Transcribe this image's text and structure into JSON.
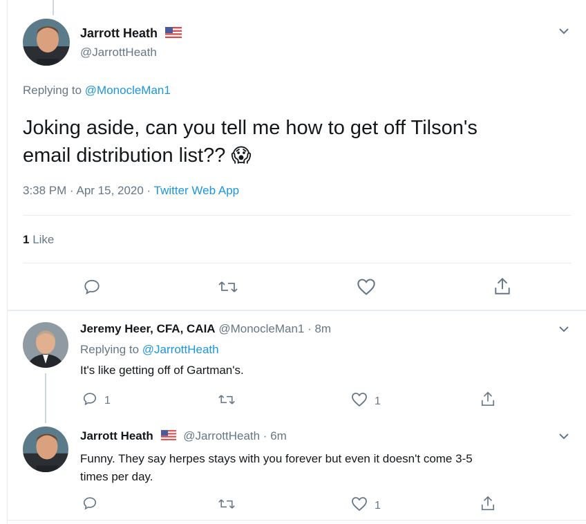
{
  "main_tweet": {
    "author_name": "Jarrott Heath",
    "handle": "@JarrottHeath",
    "replying_prefix": "Replying to",
    "replying_to": "@MonocleMan1",
    "text_line1": "Joking aside, can you tell me how to get off Tilson's",
    "text_line2": "email distribution list??",
    "emoji": "😱",
    "time_date": "3:38 PM · Apr 15, 2020 ·",
    "source": "Twitter Web App",
    "likes_count": "1",
    "likes_label": "Like"
  },
  "replies": [
    {
      "author_name": "Jeremy Heer, CFA, CAIA",
      "handle_time": "@MonocleMan1 · 8m",
      "replying_prefix": "Replying to",
      "replying_to": "@JarrottHeath",
      "text": "It's like getting off of Gartman's.",
      "reply_count": "1",
      "like_count": "1"
    },
    {
      "author_name": "Jarrott Heath",
      "handle_time": "@JarrottHeath · 6m",
      "text_line1": "Funny.  They say herpes stays with you forever but even it doesn't come 3-5",
      "text_line2": "times per day.",
      "like_count": "1"
    }
  ],
  "icons": [
    "chevron-down-icon",
    "reply-icon",
    "retweet-icon",
    "like-icon",
    "share-icon",
    "us-flag-icon"
  ],
  "colors": {
    "link": "#1b95e0",
    "muted": "#657786",
    "text": "#14171a",
    "divider": "#e6ecf0"
  }
}
